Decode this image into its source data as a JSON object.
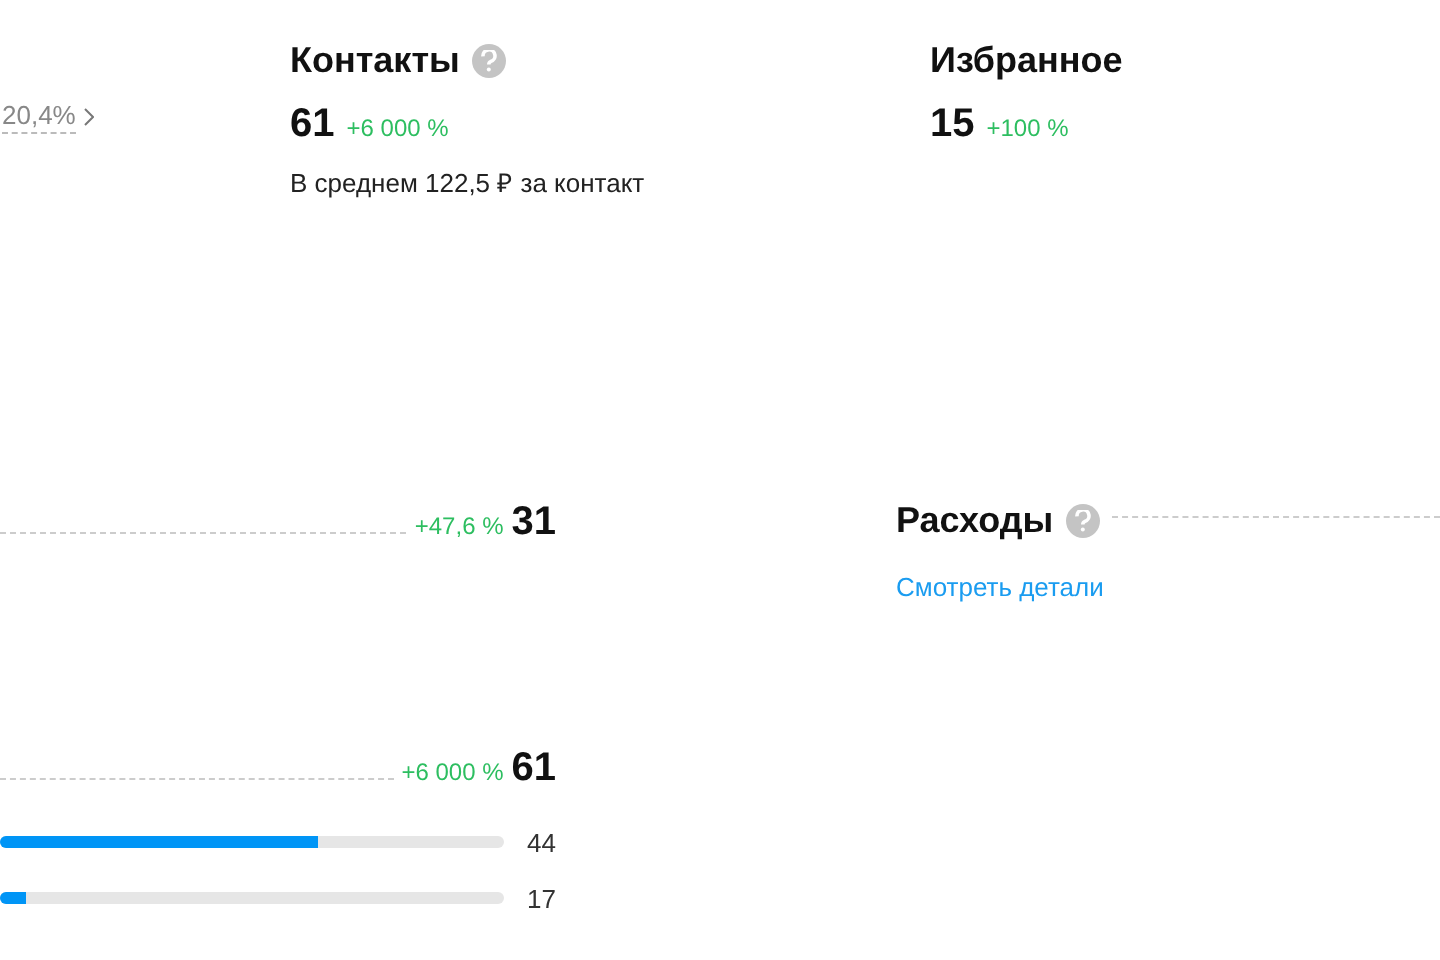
{
  "summary": [
    {
      "kind": "partial",
      "change": "20,4%"
    },
    {
      "kind": "stat",
      "title": "Контакты",
      "help": true,
      "value": "61",
      "change": "+6 000 %",
      "note": "В среднем 122,5 ₽ за контакт"
    },
    {
      "kind": "stat",
      "title": "Избранное",
      "help": false,
      "value": "15",
      "change": "+100 %"
    }
  ],
  "breakdown": {
    "rows": [
      {
        "change": "+47,6 %",
        "value": "31"
      },
      {
        "change": "+6 000 %",
        "value": "61"
      }
    ],
    "bars": [
      {
        "level": 0.63,
        "value": "44"
      },
      {
        "level": 0.05,
        "value": "17"
      }
    ]
  },
  "expenses": {
    "title": "Расходы",
    "help": true,
    "link": "Смотреть детали"
  }
}
